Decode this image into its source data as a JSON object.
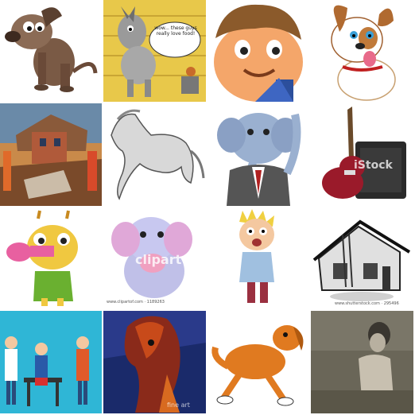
{
  "tiles": [
    {
      "name": "sad-dog-cartoon"
    },
    {
      "name": "donkey-talking-cartoon",
      "speech": "wow... these guys really love food!"
    },
    {
      "name": "boy-face-cartoon"
    },
    {
      "name": "puppy-tongue-cartoon"
    },
    {
      "name": "house-abstract-painting"
    },
    {
      "name": "horse-sketch"
    },
    {
      "name": "elephant-businessman-cartoon"
    },
    {
      "name": "guitar-amplifier",
      "watermark": "iStock"
    },
    {
      "name": "giraffe-trumpet-cartoon"
    },
    {
      "name": "elephant-pink-cartoon",
      "watermark": "clipart",
      "caption": "www.clipartof.com · 1189263"
    },
    {
      "name": "scared-boy-cartoon"
    },
    {
      "name": "haunted-house-sketch",
      "caption": "www.shutterstock.com · 295496"
    },
    {
      "name": "office-people-illustration"
    },
    {
      "name": "horse-portrait-painting",
      "watermark": "fine art"
    },
    {
      "name": "running-dog-cartoon"
    },
    {
      "name": "vintage-photo"
    }
  ],
  "colors": {
    "dog_brown": "#7a5a45",
    "bg_yellow": "#e8c84a",
    "sky_blue": "#2fb6d6"
  }
}
